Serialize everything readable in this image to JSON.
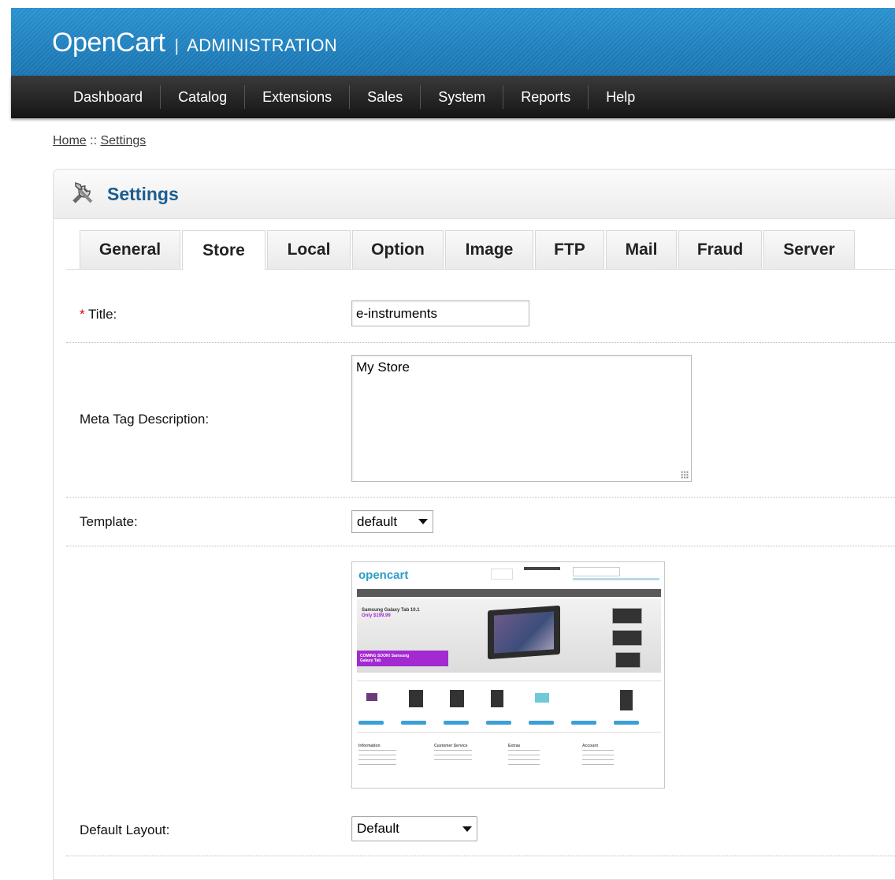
{
  "header": {
    "brand": "OpenCart",
    "separator": "|",
    "subtitle": "ADMINISTRATION"
  },
  "menu": [
    "Dashboard",
    "Catalog",
    "Extensions",
    "Sales",
    "System",
    "Reports",
    "Help"
  ],
  "breadcrumb": {
    "home": "Home",
    "sep": " :: ",
    "current": "Settings"
  },
  "panel": {
    "title": "Settings"
  },
  "tabs": [
    {
      "label": "General",
      "active": false
    },
    {
      "label": "Store",
      "active": true
    },
    {
      "label": "Local",
      "active": false
    },
    {
      "label": "Option",
      "active": false
    },
    {
      "label": "Image",
      "active": false
    },
    {
      "label": "FTP",
      "active": false
    },
    {
      "label": "Mail",
      "active": false
    },
    {
      "label": "Fraud",
      "active": false
    },
    {
      "label": "Server",
      "active": false
    }
  ],
  "form": {
    "title_required": "*",
    "title_label": " Title:",
    "title_value": "e-instruments",
    "meta_label": "Meta Tag Description:",
    "meta_value": "My Store",
    "template_label": "Template:",
    "template_value": "default",
    "layout_label": "Default Layout:",
    "layout_value": "Default"
  },
  "preview": {
    "logo": "opencart",
    "hero_line1": "Samsung Galaxy Tab 10.1",
    "hero_line2": "Only $199.99",
    "banner": "COMING SOON! Samsung Galaxy Tab",
    "footer_cols": [
      "Information",
      "Customer Service",
      "Extras",
      "Account"
    ]
  },
  "colors": {
    "header_blue": "#1f84c3",
    "menu_dark": "#1f1f1f",
    "title_blue": "#1c5c8f",
    "required_red": "#e50000"
  }
}
